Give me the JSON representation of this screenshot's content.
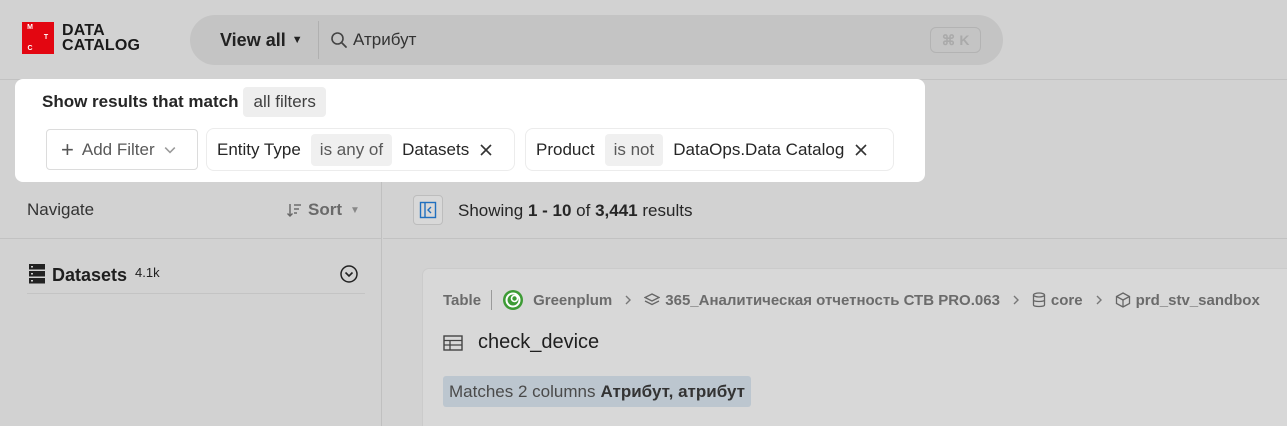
{
  "logo": {
    "letters": [
      "М",
      "Т",
      "С"
    ],
    "line1": "DATA",
    "line2": "CATALOG"
  },
  "search": {
    "scope_label": "View all",
    "query": "Атрибут",
    "shortcut": "⌘ K"
  },
  "filters": {
    "match_label": "Show results that match",
    "match_mode": "all filters",
    "add_filter_label": "Add Filter",
    "chips": [
      {
        "field": "Entity Type",
        "operator": "is any of",
        "value": "Datasets"
      },
      {
        "field": "Product",
        "operator": "is not",
        "value": "DataOps.Data Catalog"
      }
    ]
  },
  "nav": {
    "title": "Navigate",
    "sort_label": "Sort",
    "items": [
      {
        "label": "Datasets",
        "count": "4.1k"
      }
    ]
  },
  "results": {
    "showing_prefix": "Showing",
    "range": "1 - 10",
    "of": "of",
    "total": "3,441",
    "suffix": "results",
    "items": [
      {
        "type": "Table",
        "platform": "Greenplum",
        "path": [
          "365_Аналитическая отчетность СТВ PRO.063",
          "core",
          "prd_stv_sandbox"
        ],
        "name": "check_device",
        "match_text": "Matches 2 columns",
        "match_terms": "Атрибут, атрибут"
      }
    ]
  },
  "colors": {
    "brand_red": "#e30611",
    "greenplum_green": "#3d9b35",
    "accent_blue": "#1f6fbf"
  }
}
